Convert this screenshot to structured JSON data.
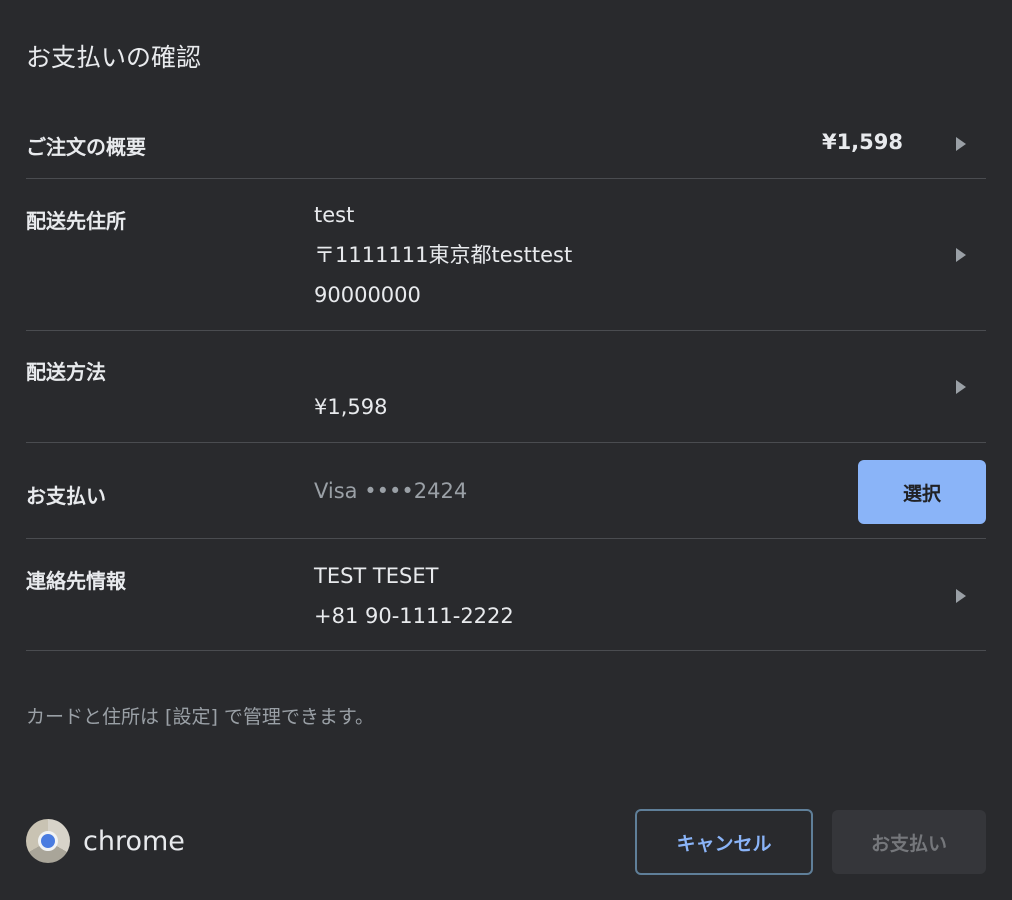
{
  "dialog": {
    "title": "お支払いの確認"
  },
  "order_summary": {
    "label": "ご注文の概要",
    "total": "¥1,598"
  },
  "shipping_address": {
    "label": "配送先住所",
    "lines": [
      "test",
      "〒1111111東京都testtest",
      "90000000"
    ]
  },
  "shipping_method": {
    "label": "配送方法",
    "value": "¥1,598"
  },
  "payment": {
    "label": "お支払い",
    "method": "Visa ••••2424",
    "select_label": "選択"
  },
  "contact": {
    "label": "連絡先情報",
    "lines": [
      "TEST TESET",
      "+81 90-1111-2222"
    ]
  },
  "footnote": {
    "before": "カードと住所は ",
    "link": "[設定]",
    "after": " で管理できます。"
  },
  "footer": {
    "brand": "chrome",
    "cancel_label": "キャンセル",
    "pay_label": "お支払い"
  }
}
